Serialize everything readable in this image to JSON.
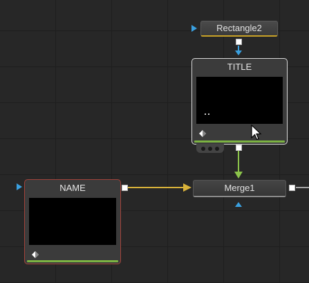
{
  "nodes": {
    "rectangle": {
      "label": "Rectangle2"
    },
    "title": {
      "label": "TITLE"
    },
    "name": {
      "label": "NAME"
    },
    "merge": {
      "label": "Merge1"
    }
  },
  "colors": {
    "background": "#272727",
    "selected_border": "#d8d8d8",
    "name_border": "#a3433a",
    "wire_yellow": "#d8b23a",
    "wire_green": "#8bc34a",
    "port_blue": "#3aa0e0"
  }
}
